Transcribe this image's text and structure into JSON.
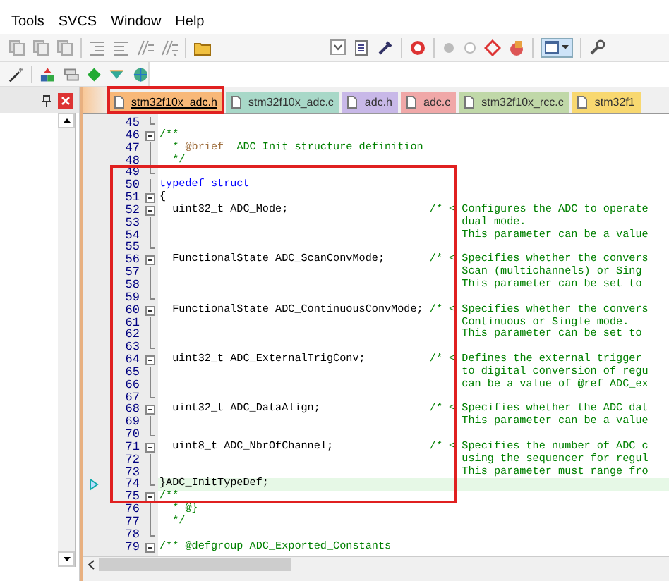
{
  "menu": [
    "Tools",
    "SVCS",
    "Window",
    "Help"
  ],
  "tabs": [
    {
      "label": "stm32f10x_adc.h",
      "selected": true,
      "color": "#f8b878"
    },
    {
      "label": "stm32f10x_adc.c",
      "selected": false,
      "color": "#a8d8c8"
    },
    {
      "label": "adc.h",
      "selected": false,
      "color": "#c8b8e8"
    },
    {
      "label": "adc.c",
      "selected": false,
      "color": "#f0a8a8"
    },
    {
      "label": "stm32f10x_rcc.c",
      "selected": false,
      "color": "#c0d8a8"
    },
    {
      "label": "stm32f1",
      "selected": false,
      "color": "#f8d870"
    }
  ],
  "editor": {
    "lines": [
      {
        "number": "45",
        "kind": "end",
        "current": false
      },
      {
        "number": "46",
        "kind": "open",
        "current": false,
        "segments": [
          {
            "kind": "comment",
            "text": "/**"
          }
        ]
      },
      {
        "number": "47",
        "kind": "plain",
        "current": false,
        "segments": [
          {
            "kind": "comment",
            "text": "  * "
          },
          {
            "kind": "tag",
            "text": "@brief"
          },
          {
            "kind": "comment",
            "text": "  ADC Init structure definition"
          }
        ]
      },
      {
        "number": "48",
        "kind": "plain",
        "current": false,
        "segments": [
          {
            "kind": "comment",
            "text": "  */"
          }
        ]
      },
      {
        "number": "49",
        "kind": "end",
        "current": false
      },
      {
        "number": "50",
        "kind": "plain",
        "current": false,
        "segments": [
          {
            "kind": "keyword",
            "text": "typedef struct"
          }
        ]
      },
      {
        "number": "51",
        "kind": "open",
        "current": false,
        "segments": [
          {
            "kind": "code",
            "text": "{"
          }
        ]
      },
      {
        "number": "52",
        "kind": "open",
        "current": false,
        "segments": [
          {
            "kind": "code",
            "text": "  uint32_t ADC_Mode;"
          }
        ],
        "comment": "/* < Configures the ADC to operate"
      },
      {
        "number": "53",
        "kind": "plain",
        "current": false,
        "comment": "dual mode."
      },
      {
        "number": "54",
        "kind": "plain",
        "current": false,
        "comment": "This parameter can be a value"
      },
      {
        "number": "55",
        "kind": "end",
        "current": false
      },
      {
        "number": "56",
        "kind": "open",
        "current": false,
        "segments": [
          {
            "kind": "code",
            "text": "  FunctionalState ADC_ScanConvMode;"
          }
        ],
        "comment": "/* < Specifies whether the convers"
      },
      {
        "number": "57",
        "kind": "plain",
        "current": false,
        "comment": "Scan (multichannels) or Sing"
      },
      {
        "number": "58",
        "kind": "plain",
        "current": false,
        "comment": "This parameter can be set to"
      },
      {
        "number": "59",
        "kind": "end",
        "current": false
      },
      {
        "number": "60",
        "kind": "open",
        "current": false,
        "segments": [
          {
            "kind": "code",
            "text": "  FunctionalState ADC_ContinuousConvMode;"
          }
        ],
        "comment": "/* < Specifies whether the convers"
      },
      {
        "number": "61",
        "kind": "plain",
        "current": false,
        "comment": "Continuous or Single mode."
      },
      {
        "number": "62",
        "kind": "plain",
        "current": false,
        "comment": "This parameter can be set to"
      },
      {
        "number": "63",
        "kind": "end",
        "current": false
      },
      {
        "number": "64",
        "kind": "open",
        "current": false,
        "segments": [
          {
            "kind": "code",
            "text": "  uint32_t ADC_ExternalTrigConv;"
          }
        ],
        "comment": "/* < Defines the external trigger"
      },
      {
        "number": "65",
        "kind": "plain",
        "current": false,
        "comment": "to digital conversion of regu"
      },
      {
        "number": "66",
        "kind": "plain",
        "current": false,
        "comment": "can be a value of @ref ADC_ex"
      },
      {
        "number": "67",
        "kind": "end",
        "current": false
      },
      {
        "number": "68",
        "kind": "open",
        "current": false,
        "segments": [
          {
            "kind": "code",
            "text": "  uint32_t ADC_DataAlign;"
          }
        ],
        "comment": "/* < Specifies whether the ADC dat"
      },
      {
        "number": "69",
        "kind": "plain",
        "current": false,
        "comment": "This parameter can be a value"
      },
      {
        "number": "70",
        "kind": "end",
        "current": false
      },
      {
        "number": "71",
        "kind": "open",
        "current": false,
        "segments": [
          {
            "kind": "code",
            "text": "  uint8_t ADC_NbrOfChannel;"
          }
        ],
        "comment": "/* < Specifies the number of ADC c"
      },
      {
        "number": "72",
        "kind": "plain",
        "current": false,
        "comment": "using the sequencer for regul"
      },
      {
        "number": "73",
        "kind": "plain",
        "current": false,
        "comment": "This parameter must range fro"
      },
      {
        "number": "74",
        "kind": "end",
        "current": true,
        "segments": [
          {
            "kind": "code",
            "text": "}ADC_InitTypeDef;"
          }
        ]
      },
      {
        "number": "75",
        "kind": "open",
        "current": false,
        "segments": [
          {
            "kind": "comment",
            "text": "/**"
          }
        ]
      },
      {
        "number": "76",
        "kind": "plain",
        "current": false,
        "segments": [
          {
            "kind": "comment",
            "text": "  * @}"
          }
        ]
      },
      {
        "number": "77",
        "kind": "plain",
        "current": false,
        "segments": [
          {
            "kind": "comment",
            "text": "  */"
          }
        ]
      },
      {
        "number": "78",
        "kind": "end",
        "current": false
      },
      {
        "number": "79",
        "kind": "open",
        "current": false,
        "segments": [
          {
            "kind": "comment",
            "text": "/** @defgroup ADC_Exported_Constants"
          }
        ]
      }
    ]
  }
}
